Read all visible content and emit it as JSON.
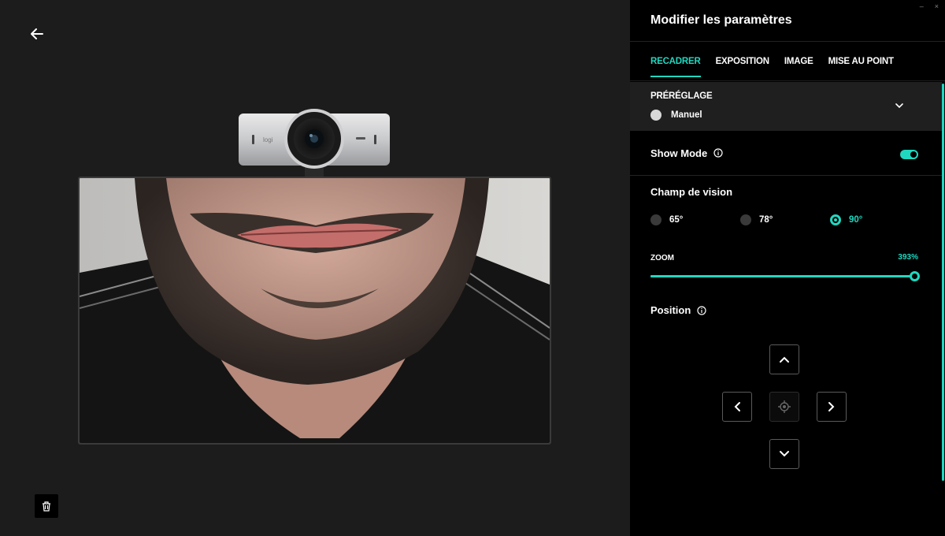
{
  "panel": {
    "title": "Modifier les paramètres",
    "window_controls": [
      "–",
      "×"
    ]
  },
  "tabs": [
    {
      "label": "RECADRER",
      "active": true
    },
    {
      "label": "EXPOSITION",
      "active": false
    },
    {
      "label": "IMAGE",
      "active": false
    },
    {
      "label": "MISE AU POINT",
      "active": false
    }
  ],
  "preset": {
    "label": "PRÉRÉGLAGE",
    "value": "Manuel"
  },
  "show_mode": {
    "label": "Show Mode",
    "enabled": true
  },
  "field_of_view": {
    "label": "Champ de vision",
    "options": [
      {
        "label": "65°",
        "selected": false
      },
      {
        "label": "78°",
        "selected": false
      },
      {
        "label": "90°",
        "selected": true
      }
    ]
  },
  "zoom": {
    "label": "ZOOM",
    "value_text": "393%",
    "level_fraction": 1.0
  },
  "position": {
    "label": "Position"
  },
  "colors": {
    "accent": "#1fd8c0",
    "panel_bg": "#000000",
    "preview_bg": "#1c1c1c"
  },
  "icons": [
    "back-arrow-icon",
    "webcam-device",
    "trash-icon",
    "info-icon",
    "chevron-down-icon",
    "arrow-up-icon",
    "arrow-left-icon",
    "arrow-right-icon",
    "arrow-down-icon",
    "crosshair-icon"
  ]
}
